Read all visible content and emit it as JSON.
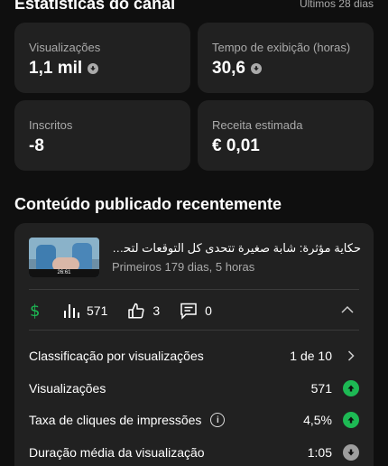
{
  "header": {
    "title": "Estatísticas do canal",
    "period": "Últimos 28 dias"
  },
  "stats": [
    {
      "label": "Visualizações",
      "value": "1,1 mil",
      "trend": "down"
    },
    {
      "label": "Tempo de exibição (horas)",
      "value": "30,6",
      "trend": "down"
    },
    {
      "label": "Inscritos",
      "value": "-8"
    },
    {
      "label": "Receita estimada",
      "value": "€ 0,01"
    }
  ],
  "recent": {
    "section_title": "Conteúdo publicado recentemente",
    "video": {
      "title": "حكاية مؤثرة: شابة صغيرة تتحدى كل التوقعات لتحقي...",
      "subtitle": "Primeiros 179 dias, 5 horas",
      "thumb_caption": "26:61"
    },
    "metrics": {
      "views": "571",
      "likes": "3",
      "comments": "0"
    },
    "details": [
      {
        "label": "Classificação por visualizações",
        "value": "1 de 10",
        "icon": "chevron-right-icon"
      },
      {
        "label": "Visualizações",
        "value": "571",
        "icon": "arrow-up-green-icon"
      },
      {
        "label": "Taxa de cliques de impressões",
        "value": "4,5%",
        "icon": "arrow-up-green-icon",
        "info": "i"
      },
      {
        "label": "Duração média da visualização",
        "value": "1:05",
        "icon": "arrow-down-grey-icon"
      }
    ]
  },
  "colors": {
    "background": "#0f0f0f",
    "card": "#212121",
    "accent_green": "#1db954",
    "muted": "#aaaaaa"
  }
}
